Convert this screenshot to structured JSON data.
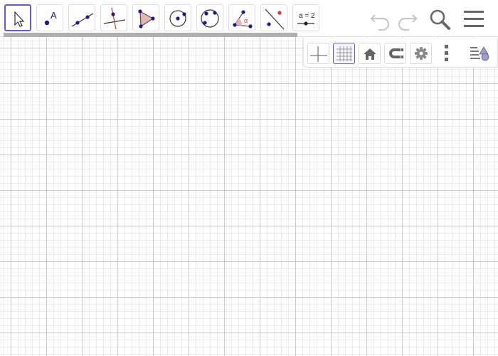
{
  "toolbar": {
    "tools": [
      {
        "name": "move-tool",
        "icon": "arrow-pointer-icon",
        "selected": true
      },
      {
        "name": "point-tool",
        "icon": "point-icon",
        "label": "A"
      },
      {
        "name": "line-tool",
        "icon": "line-icon"
      },
      {
        "name": "perpendicular-line-tool",
        "icon": "perpendicular-line-icon"
      },
      {
        "name": "polygon-tool",
        "icon": "polygon-icon"
      },
      {
        "name": "circle-center-point-tool",
        "icon": "circle-center-icon"
      },
      {
        "name": "circle-three-points-tool",
        "icon": "circle-three-points-icon"
      },
      {
        "name": "angle-tool",
        "icon": "angle-icon",
        "label": "α"
      },
      {
        "name": "reflect-tool",
        "icon": "reflect-about-line-icon"
      },
      {
        "name": "slider-tool",
        "icon": "slider-icon",
        "label": "a = 2"
      }
    ],
    "undo_icon": "undo-icon",
    "redo_icon": "redo-icon",
    "search_icon": "search-icon",
    "menu_icon": "hamburger-menu-icon"
  },
  "style_bar": {
    "buttons": [
      {
        "name": "toggle-axes-button",
        "icon": "axes-icon",
        "active": false
      },
      {
        "name": "toggle-grid-button",
        "icon": "grid-icon",
        "active": true
      },
      {
        "name": "standard-view-button",
        "icon": "home-icon",
        "active": false
      },
      {
        "name": "point-capturing-button",
        "icon": "magnet-icon",
        "active": false
      },
      {
        "name": "settings-button",
        "icon": "gear-icon",
        "active": false
      },
      {
        "name": "more-options-button",
        "icon": "vertical-dots-icon",
        "active": false
      },
      {
        "name": "toggle-style-bar-button",
        "icon": "style-bar-toggle-icon",
        "active": false
      }
    ]
  },
  "colors": {
    "accent": "#6557d2",
    "point": "#1a1a99",
    "construction_red": "#cc3333",
    "polygon_fill": "#e8b4b4",
    "grid_major": "#c9c9c9",
    "grid_minor": "#eaeaea",
    "icon_gray": "#666666",
    "icon_disabled": "#c8c8c8"
  }
}
